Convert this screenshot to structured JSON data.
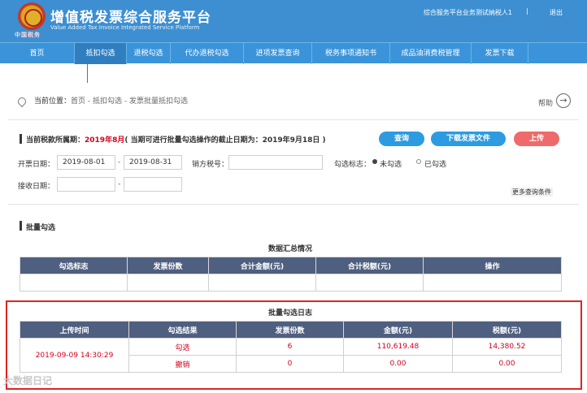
{
  "header": {
    "title": "增值税发票综合服务平台",
    "subtitle": "Value Added Tax Invoice Integrated Service Platform",
    "emblem_caption": "中国税务",
    "user": "综合服务平台业务测试纳税人1",
    "separator": "|",
    "logout": "退出"
  },
  "nav": {
    "items": [
      {
        "label": "首页"
      },
      {
        "label": "抵扣勾选"
      },
      {
        "label": "退税勾选"
      },
      {
        "label": "代办退税勾选"
      },
      {
        "label": "进项发票查询"
      },
      {
        "label": "税务事项通知书"
      },
      {
        "label": "成品油消费税管理"
      },
      {
        "label": "发票下载"
      }
    ],
    "active_index": 1
  },
  "breadcrumb": {
    "label": "当前位置：",
    "path": "首页 - 抵扣勾选 - 发票批量抵扣勾选",
    "help": "帮助",
    "help_icon": "arrow-right-circle-icon"
  },
  "query": {
    "deadline_label": "当前税款所属期：",
    "period": "2019年8月",
    "deadline_note": "( 当期可进行批量勾选操作的截止日期为：2019年9月18日 )",
    "buttons": {
      "query": "查询",
      "download": "下载发票文件",
      "upload": "上传"
    },
    "invoice_date_label": "开票日期：",
    "date_from": "2019-08-01",
    "dash": "-",
    "date_to": "2019-08-31",
    "seller_tax_label": "销方税号：",
    "seller_tax_value": "",
    "select_flag_label": "勾选标志：",
    "radio_unselected": "未勾选",
    "radio_selected": "已勾选",
    "receive_date_label": "接收日期：",
    "receive_from": "",
    "receive_to": "",
    "more_conditions": "更多查询条件"
  },
  "batch": {
    "section_title": "批量勾选",
    "summary_caption": "数据汇总情况",
    "summary_headers": [
      "勾选标志",
      "发票份数",
      "合计金额(元)",
      "合计税额(元)",
      "操作"
    ],
    "log_caption": "批量勾选日志",
    "log_headers": [
      "上传时间",
      "勾选结果",
      "发票份数",
      "金额(元)",
      "税额(元)"
    ],
    "log_time": "2019-09-09 14:30:29",
    "log_rows": [
      {
        "result": "勾选",
        "count": "6",
        "amount": "110,619.48",
        "tax": "14,380.52"
      },
      {
        "result": "撤销",
        "count": "0",
        "amount": "0.00",
        "tax": "0.00"
      }
    ]
  },
  "watermark": "大数据日记",
  "colors": {
    "header_blue": "#3d8fd1",
    "table_header": "#4f5f80",
    "accent_red": "#d0021b",
    "button_blue": "#2d9be0",
    "button_red": "#ef6a6a"
  }
}
